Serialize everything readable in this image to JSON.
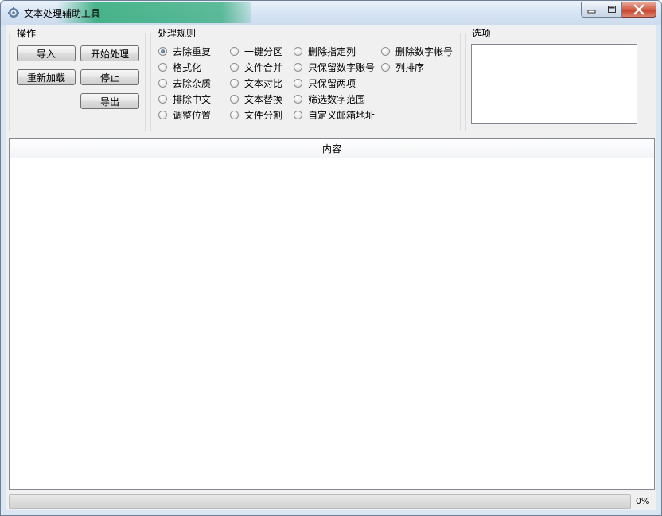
{
  "window": {
    "title": "文本处理辅助工具",
    "icon": "gear-icon",
    "controls": [
      "minimize-icon",
      "maximize-icon",
      "close-icon"
    ]
  },
  "operations": {
    "title": "操作",
    "import_label": "导入",
    "start_label": "开始处理",
    "reload_label": "重新加载",
    "stop_label": "停止",
    "export_label": "导出"
  },
  "rules": {
    "title": "处理规则",
    "selected": "去除重复",
    "items": [
      "去除重复",
      "格式化",
      "去除杂质",
      "排除中文",
      "调整位置",
      "一键分区",
      "文件合并",
      "文本对比",
      "文本替换",
      "文件分割",
      "删除指定列",
      "只保留数字账号",
      "只保留两项",
      "筛选数字范围",
      "自定义邮箱地址",
      "删除数字帐号",
      "列排序"
    ]
  },
  "options": {
    "title": "选项"
  },
  "content": {
    "header": "内容"
  },
  "progress": {
    "value": 0,
    "text": "0%"
  },
  "colors": {
    "progress_fill": "#06b025",
    "close_button": "#c8452c"
  }
}
